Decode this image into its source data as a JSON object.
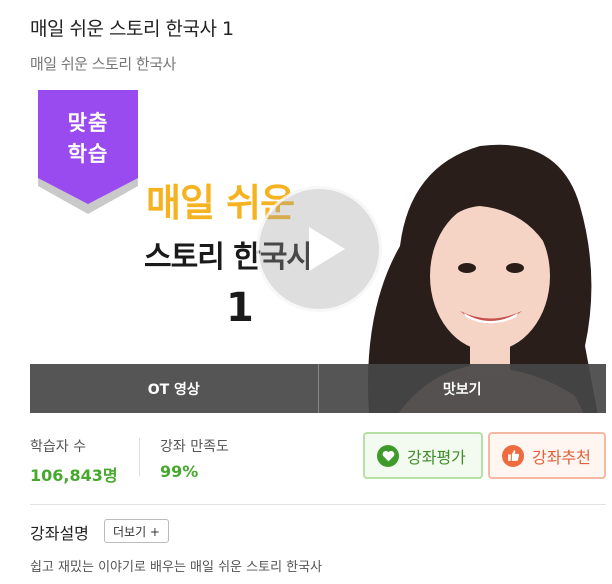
{
  "header": {
    "title": "매일 쉬운 스토리 한국사 1",
    "subtitle": "매일 쉬운 스토리 한국사"
  },
  "thumbnail": {
    "badge": [
      "맞춤",
      "학습"
    ],
    "course_lines": [
      "매일 쉬운",
      "스토리 한국사",
      "1"
    ],
    "buttons": {
      "ot": "OT 영상",
      "preview": "맛보기"
    }
  },
  "stats": {
    "learners_label": "학습자 수",
    "learners_value": "106,843명",
    "satisfaction_label": "강좌 만족도",
    "satisfaction_value": "99%"
  },
  "actions": {
    "rate": "강좌평가",
    "recommend": "강좌추천"
  },
  "description": {
    "title": "강좌설명",
    "more": "더보기 +",
    "text": "쉽고 재밌는 이야기로 배우는 매일 쉬운 스토리 한국사"
  },
  "colors": {
    "badge": "#9a4bf0",
    "course_highlight": "#f5b321",
    "stat_green": "#46a82d",
    "rate_green": "#3e9b2a",
    "recommend_orange": "#ee6b40"
  },
  "icons": [
    "play-icon",
    "heart-icon",
    "thumbs-up-icon"
  ]
}
